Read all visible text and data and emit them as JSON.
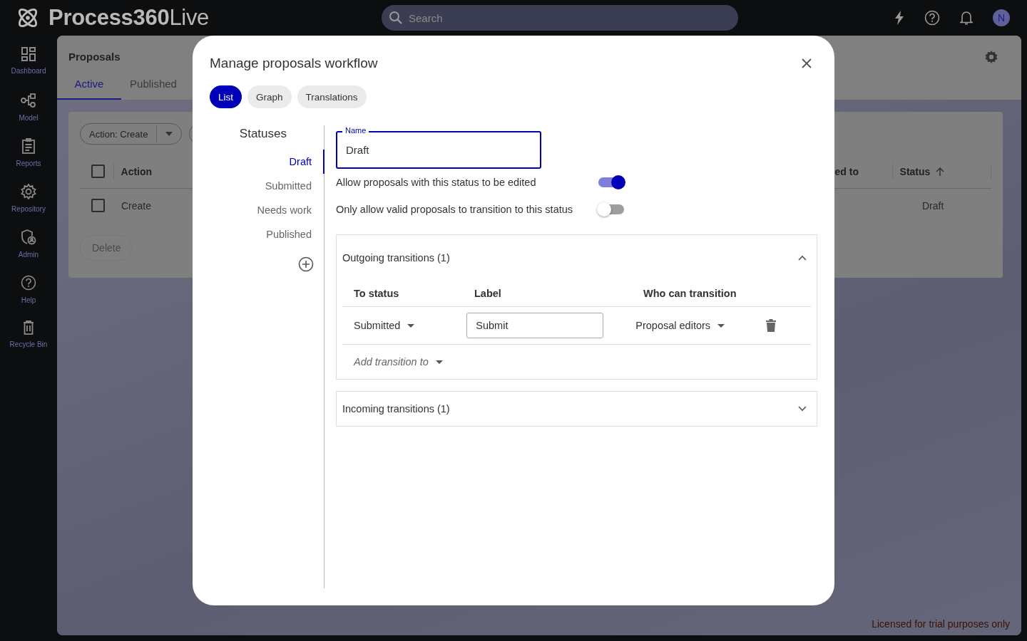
{
  "app": {
    "name_bold": "Process360",
    "name_light": "Live"
  },
  "search": {
    "placeholder": "Search"
  },
  "user": {
    "initial": "N"
  },
  "sidebar": {
    "items": [
      {
        "label": "Dashboard",
        "kind": "dashboard"
      },
      {
        "label": "Model",
        "kind": "model"
      },
      {
        "label": "Reports",
        "kind": "reports"
      },
      {
        "label": "Repository",
        "kind": "repository"
      },
      {
        "label": "Admin",
        "kind": "admin"
      },
      {
        "label": "Help",
        "kind": "help"
      },
      {
        "label": "Recycle Bin",
        "kind": "bin"
      }
    ]
  },
  "page": {
    "title": "Proposals",
    "tabs": [
      {
        "label": "Active",
        "selected": true
      },
      {
        "label": "Published",
        "selected": false
      }
    ],
    "filter": {
      "label": "Action: Create"
    },
    "table": {
      "select_all_checked": false,
      "columns": [
        {
          "label": "Action",
          "sorted": false
        },
        {
          "label": "ed to",
          "sorted": false
        },
        {
          "label": "Status",
          "sorted": true
        }
      ],
      "rows": [
        {
          "checked": false,
          "action": "Create",
          "status": "Draft"
        }
      ]
    },
    "delete_button": {
      "label": "Delete",
      "disabled": true
    },
    "license_notice": "Licensed for trial purposes only"
  },
  "modal": {
    "title": "Manage proposals workflow",
    "view_tabs": [
      {
        "label": "List",
        "selected": true
      },
      {
        "label": "Graph",
        "selected": false
      },
      {
        "label": "Translations",
        "selected": false
      }
    ],
    "statuses": {
      "heading": "Statuses",
      "items": [
        {
          "label": "Draft",
          "selected": true
        },
        {
          "label": "Submitted",
          "selected": false
        },
        {
          "label": "Needs work",
          "selected": false
        },
        {
          "label": "Published",
          "selected": false
        }
      ]
    },
    "name_field": {
      "label": "Name",
      "value": "Draft"
    },
    "toggles": [
      {
        "label": "Allow proposals with this status to be edited",
        "on": true
      },
      {
        "label": "Only allow valid proposals to transition to this status",
        "on": false
      }
    ],
    "outgoing": {
      "title": "Outgoing transitions (1)",
      "expanded": true,
      "columns": [
        "To status",
        "Label",
        "Who can transition"
      ],
      "rows": [
        {
          "to_status": "Submitted",
          "label": "Submit",
          "who": "Proposal editors"
        }
      ],
      "add_placeholder": "Add transition to"
    },
    "incoming": {
      "title": "Incoming transitions (1)",
      "expanded": false
    }
  }
}
